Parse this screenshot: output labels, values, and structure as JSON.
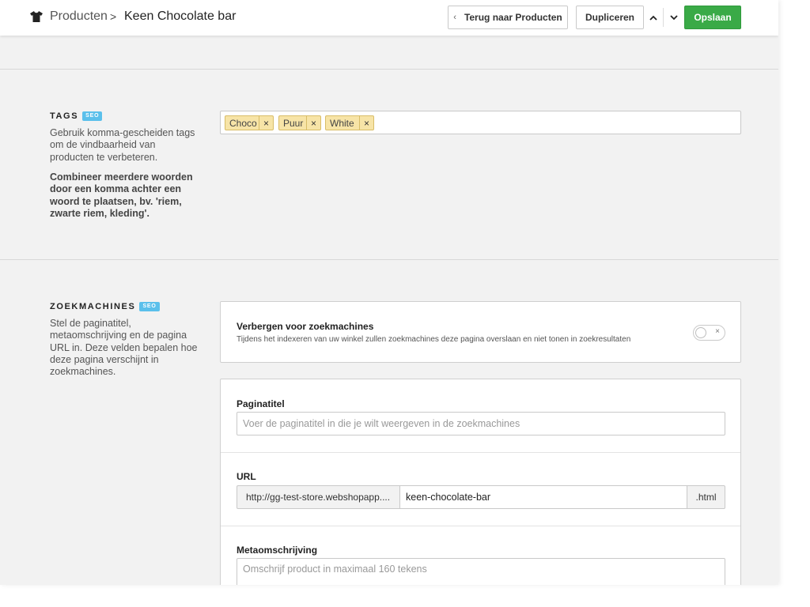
{
  "header": {
    "breadcrumb_root": "Producten",
    "breadcrumb_separator": ">",
    "breadcrumb_current": "Keen Chocolate bar",
    "back_button_label": "Terug naar Producten",
    "duplicate_button_label": "Dupliceren",
    "save_button_label": "Opslaan",
    "icon": "tshirt-icon"
  },
  "tags_section": {
    "title": "TAGS",
    "badge": "SEO",
    "description": "Gebruik komma-gescheiden tags om de vindbaarheid van producten te verbeteren.",
    "hint": "Combineer meerdere woorden door een komma achter een woord te plaatsen, bv. 'riem, zwarte riem, kleding'.",
    "tags": [
      {
        "label": "Choco",
        "remove": "×"
      },
      {
        "label": "Puur",
        "remove": "×"
      },
      {
        "label": "White",
        "remove": "×"
      }
    ]
  },
  "seo_section": {
    "title": "ZOEKMACHINES",
    "badge": "SEO",
    "description": "Stel de paginatitel, metaomschrijving en de pagina URL in. Deze velden bepalen hoe deze pagina verschijnt in zoekmachines.",
    "hide": {
      "title": "Verbergen voor zoekmachines",
      "description": "Tijdens het indexeren van uw winkel zullen zoekmachines deze pagina overslaan en niet tonen in zoekresultaten",
      "toggle_off_symbol": "×"
    },
    "page_title": {
      "label": "Paginatitel",
      "placeholder": "Voer de paginatitel in die je wilt weergeven in de zoekmachines"
    },
    "url": {
      "label": "URL",
      "prefix": "http://gg-test-store.webshopapp....",
      "slug": "keen-chocolate-bar",
      "suffix": ".html"
    },
    "meta": {
      "label": "Metaomschrijving",
      "placeholder": "Omschrijf product in maximaal 160 tekens"
    }
  },
  "colors": {
    "save_green": "#3aaa47",
    "seo_badge_blue": "#5bc0eb",
    "tag_yellow": "#f7e4a7"
  }
}
